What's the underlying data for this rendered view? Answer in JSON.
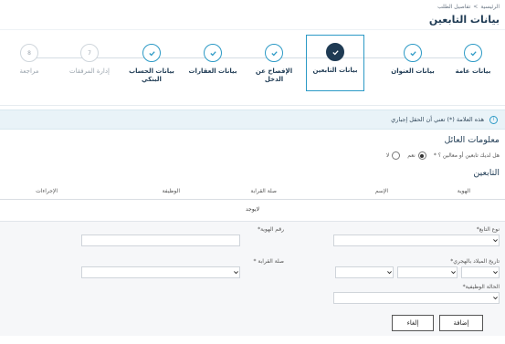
{
  "breadcrumb": {
    "home": "الرئيسية",
    "separator": ">",
    "current": "تفاصيل الطلب"
  },
  "page_title": "بيانات التابعين",
  "steps": [
    {
      "label": "بيانات عامة",
      "state": "done"
    },
    {
      "label": "بيانات العنوان",
      "state": "done"
    },
    {
      "label": "بيانات التابعين",
      "state": "active"
    },
    {
      "label": "الإفصاح عن الدخل",
      "state": "done"
    },
    {
      "label": "بيانات العقارات",
      "state": "done"
    },
    {
      "label": "بيانات الحساب البنكي",
      "state": "done"
    },
    {
      "label": "إدارة المرفقات",
      "state": "pending",
      "number": "7"
    },
    {
      "label": "مراجعة",
      "state": "pending",
      "number": "8"
    }
  ],
  "notice": {
    "text": "هذه العلامة (*) تعني أن الحقل إجباري",
    "icon": "info-icon"
  },
  "family_section": {
    "title": "معلومات العائل",
    "question": "هل لديك تابعين أو معالين ؟ *",
    "options": [
      {
        "label": "نعم",
        "selected": true
      },
      {
        "label": "لا",
        "selected": false
      }
    ]
  },
  "dependents": {
    "title": "التابعين",
    "columns": [
      "الهوية",
      "الإسم",
      "صلة القرابة",
      "الوظيفة",
      "الإجراءات"
    ],
    "empty_text": "لايوجد"
  },
  "form": {
    "id_type_label": "نوع التابع*",
    "id_number_label": "رقم الهوية*",
    "hijri_dob_label": "تاريخ الميلاد بالهجري*",
    "relation_label": "صلة القرابة *",
    "job_status_label": "الحالة الوظيفية*",
    "add_button": "إضافة",
    "cancel_button": "إلغاء"
  },
  "colors": {
    "accent": "#2c9ac6",
    "title": "#1f3b54",
    "notice_bg": "#e9f3f8"
  }
}
